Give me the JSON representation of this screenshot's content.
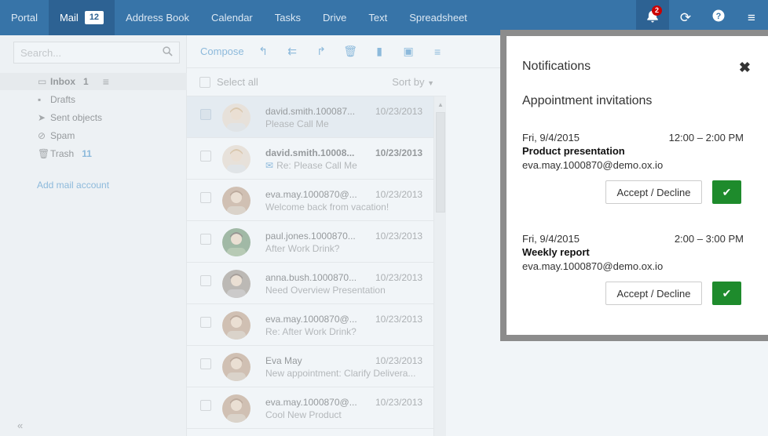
{
  "topnav": {
    "tabs": [
      {
        "label": "Portal"
      },
      {
        "label": "Mail",
        "badge": "12"
      },
      {
        "label": "Address Book"
      },
      {
        "label": "Calendar"
      },
      {
        "label": "Tasks"
      },
      {
        "label": "Drive"
      },
      {
        "label": "Text"
      },
      {
        "label": "Spreadsheet"
      }
    ],
    "notification_count": "2",
    "icons": [
      "bell-icon",
      "refresh-icon",
      "help-icon",
      "menu-icon"
    ]
  },
  "sidebar": {
    "search_placeholder": "Search...",
    "folders": [
      {
        "icon": "inbox-icon",
        "label": "Inbox",
        "count": "1"
      },
      {
        "icon": "drafts-icon",
        "label": "Drafts",
        "count": ""
      },
      {
        "icon": "sent-icon",
        "label": "Sent objects",
        "count": ""
      },
      {
        "icon": "spam-icon",
        "label": "Spam",
        "count": ""
      },
      {
        "icon": "trash-icon",
        "label": "Trash",
        "count": "11"
      }
    ],
    "add_account": "Add mail account",
    "collapse": "«"
  },
  "toolbar": {
    "compose": "Compose",
    "icons": [
      "reply-icon",
      "reply-all-icon",
      "forward-icon",
      "delete-icon",
      "flag-icon",
      "archive-icon",
      "more-icon"
    ]
  },
  "list": {
    "select_all": "Select all",
    "sort_by": "Sort by",
    "messages": [
      {
        "from": "david.smith.100087...",
        "date": "10/23/2013",
        "subject": "Please Call Me",
        "selected": true,
        "unread": false,
        "avatar": "david"
      },
      {
        "from": "david.smith.10008...",
        "date": "10/23/2013",
        "subject": "Re: Please Call Me",
        "selected": false,
        "unread": true,
        "avatar": "david"
      },
      {
        "from": "eva.may.1000870@...",
        "date": "10/23/2013",
        "subject": "Welcome back from vacation!",
        "selected": false,
        "unread": false,
        "avatar": "eva"
      },
      {
        "from": "paul.jones.1000870...",
        "date": "10/23/2013",
        "subject": "After Work Drink?",
        "selected": false,
        "unread": false,
        "avatar": "paul"
      },
      {
        "from": "anna.bush.1000870...",
        "date": "10/23/2013",
        "subject": "Need Overview Presentation",
        "selected": false,
        "unread": false,
        "avatar": "anna"
      },
      {
        "from": "eva.may.1000870@...",
        "date": "10/23/2013",
        "subject": "Re: After Work Drink?",
        "selected": false,
        "unread": false,
        "avatar": "eva"
      },
      {
        "from": "Eva May",
        "date": "10/23/2013",
        "subject": "New appointment: Clarify Delivera...",
        "selected": false,
        "unread": false,
        "avatar": "eva"
      },
      {
        "from": "eva.may.1000870@...",
        "date": "10/23/2013",
        "subject": "Cool New Product",
        "selected": false,
        "unread": false,
        "avatar": "eva"
      }
    ]
  },
  "notifications": {
    "title": "Notifications",
    "section": "Appointment invitations",
    "items": [
      {
        "date": "Fri, 9/4/2015",
        "time": "12:00 – 2:00 PM",
        "title": "Product presentation",
        "email": "eva.may.1000870@demo.ox.io",
        "accept_label": "Accept / Decline"
      },
      {
        "date": "Fri, 9/4/2015",
        "time": "2:00 – 3:00 PM",
        "title": "Weekly report",
        "email": "eva.may.1000870@demo.ox.io",
        "accept_label": "Accept / Decline"
      }
    ]
  },
  "colors": {
    "topbar": "#3774a8",
    "accent": "#1f7abf",
    "accept_green": "#1e8b2c"
  }
}
